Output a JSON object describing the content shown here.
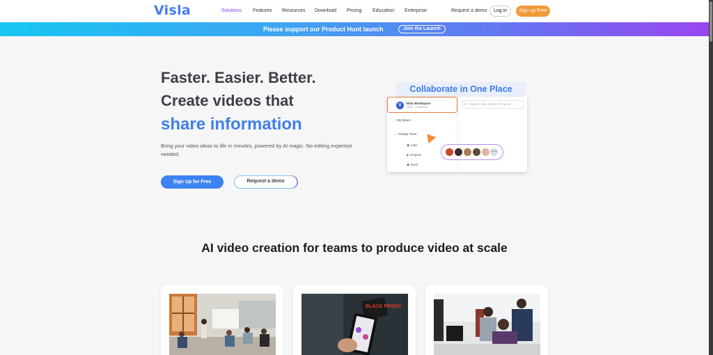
{
  "nav": {
    "logo": "Visla",
    "items": [
      "Solutions",
      "Features",
      "Resources",
      "Download",
      "Pricing",
      "Education",
      "Enterprise"
    ],
    "request_demo": "Request a demo",
    "login": "Log in",
    "signup": "Sign up Free"
  },
  "banner": {
    "text": "Please support our Product Hunt launch",
    "button": "Join the Launch"
  },
  "hero": {
    "line1": "Faster. Easier. Better.",
    "line2": "Create videos that",
    "line3": "share information",
    "description": "Bring your video ideas to life in minutes, powered by AI magic. No editing expertise needed.",
    "primary_button": "Sign Up for Free",
    "secondary_button": "Request a demo"
  },
  "illustration": {
    "title": "Collaborate in One Place",
    "search_placeholder": "Search clips, folders, Projects",
    "workspace_name": "Visla Workspace",
    "workspace_sub": "Owner · 3 members",
    "rows": [
      "My Space",
      "Design Team"
    ],
    "sub_rows": [
      "Clips",
      "Projects",
      "Stock"
    ],
    "avatar_more": "+++"
  },
  "section": {
    "title": "AI video creation for teams to produce video at scale"
  },
  "cards": [
    {
      "image": "team-meeting-photo"
    },
    {
      "image": "phone-shopping-photo",
      "sign_text": "BLACK FRIDAY"
    },
    {
      "image": "office-desk-photo"
    }
  ],
  "colors": {
    "brand_blue": "#3f7fe9",
    "accent_purple": "#8a3ff0",
    "cta_orange": "#f29a3a"
  }
}
